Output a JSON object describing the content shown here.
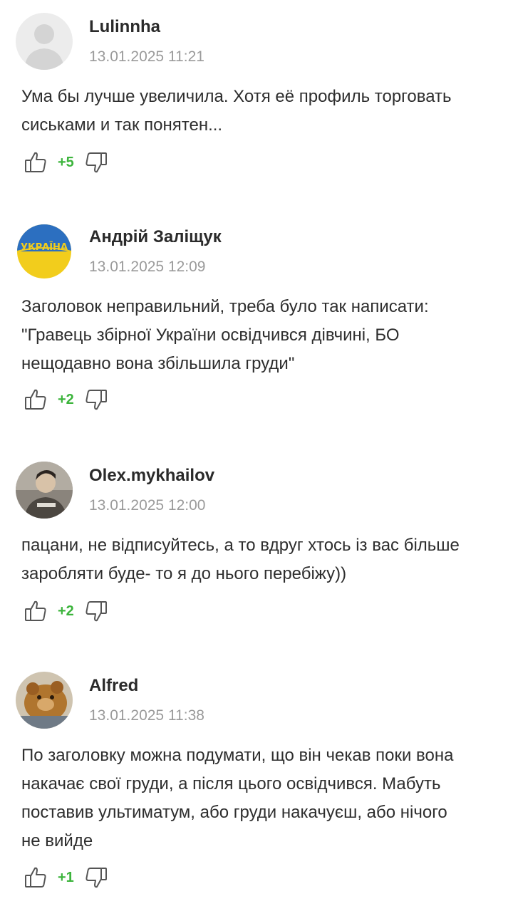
{
  "comments": [
    {
      "author": "Lulinnha",
      "date": "13.01.2025 11:21",
      "lines": [
        "Ума бы лучше увеличила. Хотя её профиль торговать",
        "сиськами и так понятен..."
      ],
      "score": "+5",
      "avatar_icon": "default-user-avatar-icon"
    },
    {
      "author": "Андрій Заліщук",
      "date": "13.01.2025 12:09",
      "lines": [
        "Заголовок неправильний, треба було так написати:",
        "\"Гравець збірної України освідчився дівчині, БО",
        "нещодавно вона збільшила груди\""
      ],
      "score": "+2",
      "avatar_icon": "ukraine-ball-avatar-icon"
    },
    {
      "author": "Olex.mykhailov",
      "date": "13.01.2025 12:00",
      "lines": [
        "пацани, не відписуйтесь, а то вдруг хтось із вас більше",
        "заробляти буде- то я до нього перебіжу))"
      ],
      "score": "+2",
      "avatar_icon": "photo-avatar-icon"
    },
    {
      "author": "Alfred",
      "date": "13.01.2025 11:38",
      "lines": [
        "По заголовку можна подумати, що він чекав поки вона",
        "накачає свої груди, а після цього освідчився. Мабуть",
        "поставив ультиматум, або груди накачуєш, або нічого",
        "не вийде"
      ],
      "score": "+1",
      "avatar_icon": "bear-photo-avatar-icon"
    }
  ],
  "colors": {
    "score": "#3cb43c",
    "date": "#9a9a9a",
    "author": "#2a2a2a"
  }
}
